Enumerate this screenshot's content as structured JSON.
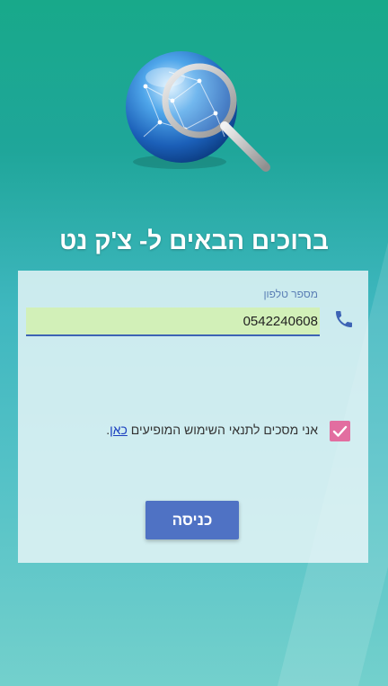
{
  "app": {
    "welcome_title": "ברוכים הבאים ל- צ'ק נט",
    "logo_icon": "globe-magnifier-icon"
  },
  "form": {
    "phone_label": "מספר טלפון",
    "phone_value": "0542240608",
    "phone_icon": "phone-icon",
    "agree_text": "אני מסכים לתנאי השימוש המופיעים",
    "agree_link": "כאן",
    "agree_suffix": ".",
    "agree_checked": true,
    "submit_label": "כניסה"
  },
  "colors": {
    "gradient_top": "#18a98a",
    "gradient_bottom": "#73d0cc",
    "input_bg": "#d2f0b8",
    "input_underline": "#3d63b5",
    "checkbox": "#e26ea0",
    "button": "#4f72c4",
    "label": "#5b7fb5"
  }
}
